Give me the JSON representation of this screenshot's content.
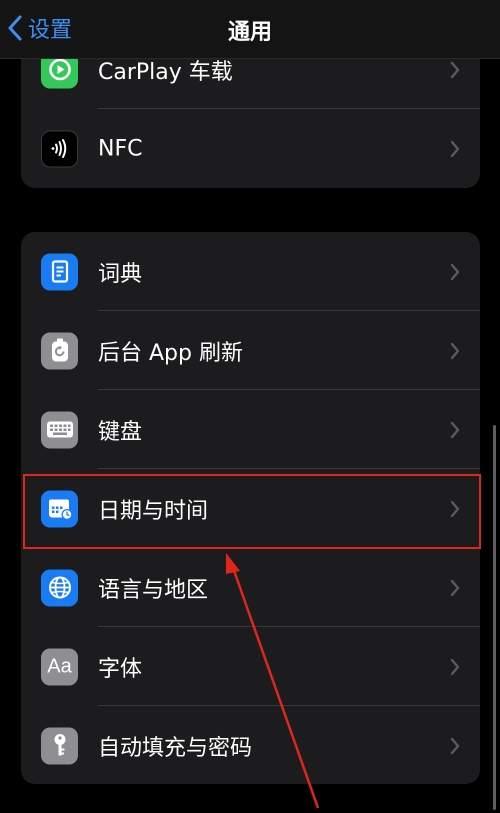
{
  "nav": {
    "back_label": "设置",
    "title": "通用"
  },
  "group1": [
    {
      "label": "CarPlay 车载",
      "icon": "carplay-icon",
      "color": "#34c759"
    },
    {
      "label": "NFC",
      "icon": "nfc-icon",
      "color": "#000000"
    }
  ],
  "group2": [
    {
      "label": "词典",
      "icon": "dictionary-icon",
      "color": "#1a7cf5"
    },
    {
      "label": "后台 App 刷新",
      "icon": "background-refresh-icon",
      "color": "#8e8e93"
    },
    {
      "label": "键盘",
      "icon": "keyboard-icon",
      "color": "#8e8e93"
    },
    {
      "label": "日期与时间",
      "icon": "date-time-icon",
      "color": "#1a7cf5"
    },
    {
      "label": "语言与地区",
      "icon": "globe-icon",
      "color": "#1a7cf5"
    },
    {
      "label": "字体",
      "icon": "font-icon",
      "color": "#8e8e93",
      "glyph": "Aa"
    },
    {
      "label": "自动填充与密码",
      "icon": "key-icon",
      "color": "#8e8e93"
    }
  ],
  "annotation": {
    "highlight_color": "#e0261c"
  }
}
